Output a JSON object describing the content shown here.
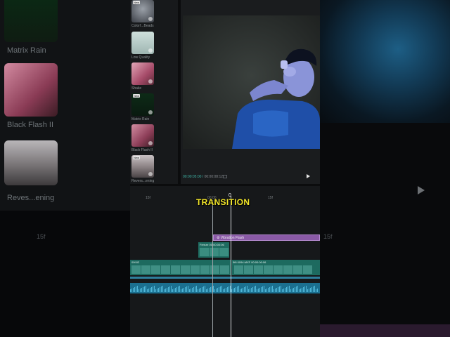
{
  "caption": "TRANSITION",
  "bg_left": {
    "labels": [
      "Matrix Rain",
      "Black Flash II",
      "Reves...ening"
    ]
  },
  "bg_right": {
    "ruler_label": "15f"
  },
  "bg_left_ruler": "15f",
  "effects": [
    {
      "label": "Colorf...Beads",
      "new": true
    },
    {
      "label": "Low Quality",
      "new": false
    },
    {
      "label": "Shake",
      "new": false
    },
    {
      "label": "Matrix Rain",
      "new": true
    },
    {
      "label": "Black Flash II",
      "new": false
    },
    {
      "label": "Revers...ening",
      "new": true
    }
  ],
  "badge_new": "New",
  "preview": {
    "current_time": "00:00:05:00",
    "total_time": "00:00:08:12"
  },
  "ruler": {
    "labels": [
      "15f",
      "00:00",
      "0",
      "15f"
    ]
  },
  "timeline": {
    "fx_clip_label": "Vibration Flash",
    "overlay_clip_label": "Freeze  00:00:00:06",
    "main_clip_a_label": "00f.82",
    "main_clip_b_label": "5f6  0094.MXF  00:00:00:06"
  },
  "colors": {
    "caption": "#f5e829",
    "fx_clip": "#8a5aa6",
    "video_clip": "#1d6a5f",
    "audio_clip": "#1b6f8f",
    "timecode": "#3fb5a7"
  },
  "icons": {
    "play": "play-icon",
    "download": "download-icon"
  }
}
